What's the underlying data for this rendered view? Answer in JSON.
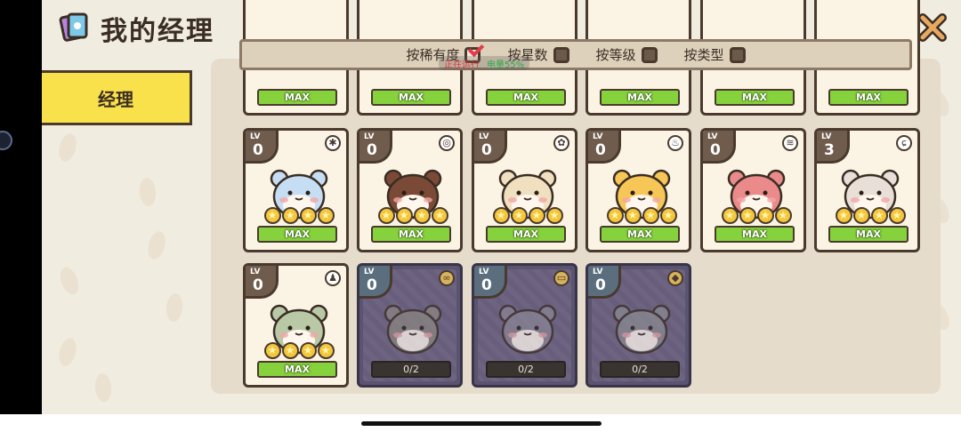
{
  "header": {
    "title": "我的经理",
    "title_icon": "manager-cards-icon",
    "close_icon": "close-icon"
  },
  "sidebar": {
    "tabs": [
      {
        "label": "经理",
        "active": true
      }
    ]
  },
  "filters": [
    {
      "label": "按稀有度",
      "checked": true
    },
    {
      "label": "按星数",
      "checked": false
    },
    {
      "label": "按等级",
      "checked": false
    },
    {
      "label": "按类型",
      "checked": false
    }
  ],
  "status_overlay": {
    "red_text": "正在运行",
    "green_text": "电量55%"
  },
  "top_row_cards": [
    {
      "max_label": "MAX"
    },
    {
      "max_label": "MAX"
    },
    {
      "max_label": "MAX"
    },
    {
      "max_label": "MAX"
    },
    {
      "max_label": "MAX"
    },
    {
      "max_label": "MAX"
    }
  ],
  "cards": [
    {
      "lv_label": "LV",
      "level": "0",
      "type_icon": "sparkle-icon",
      "fur": "#c6def4",
      "stars": 4,
      "max_label": "MAX",
      "locked": false
    },
    {
      "lv_label": "LV",
      "level": "0",
      "type_icon": "coin-stack-icon",
      "fur": "#7a4a36",
      "stars": 4,
      "max_label": "MAX",
      "locked": false
    },
    {
      "lv_label": "LV",
      "level": "0",
      "type_icon": "gear-icon",
      "fur": "#f0e0c0",
      "stars": 4,
      "max_label": "MAX",
      "locked": false
    },
    {
      "lv_label": "LV",
      "level": "0",
      "type_icon": "drumstick-icon",
      "fur": "#f6c656",
      "stars": 4,
      "max_label": "MAX",
      "locked": false
    },
    {
      "lv_label": "LV",
      "level": "0",
      "type_icon": "coins-icon",
      "fur": "#ea8a8a",
      "stars": 4,
      "max_label": "MAX",
      "locked": false
    },
    {
      "lv_label": "LV",
      "level": "3",
      "type_icon": "cherry-icon",
      "fur": "#e8e0d8",
      "stars": 4,
      "max_label": "MAX",
      "locked": false
    },
    {
      "lv_label": "LV",
      "level": "0",
      "type_icon": "person-icon",
      "fur": "#b9c9a6",
      "stars": 4,
      "max_label": "MAX",
      "locked": false
    },
    {
      "lv_label": "LV",
      "level": "0",
      "type_icon": "peanut-icon",
      "fur": "#8a8680",
      "stars": 0,
      "progress_label": "0/2",
      "progress": 0,
      "locked": true
    },
    {
      "lv_label": "LV",
      "level": "0",
      "type_icon": "ticket-icon",
      "fur": "#8a8494",
      "stars": 0,
      "progress_label": "0/2",
      "progress": 0,
      "locked": true
    },
    {
      "lv_label": "LV",
      "level": "0",
      "type_icon": "gem-icon",
      "fur": "#8a8a90",
      "stars": 0,
      "progress_label": "0/2",
      "progress": 0,
      "locked": true
    }
  ]
}
